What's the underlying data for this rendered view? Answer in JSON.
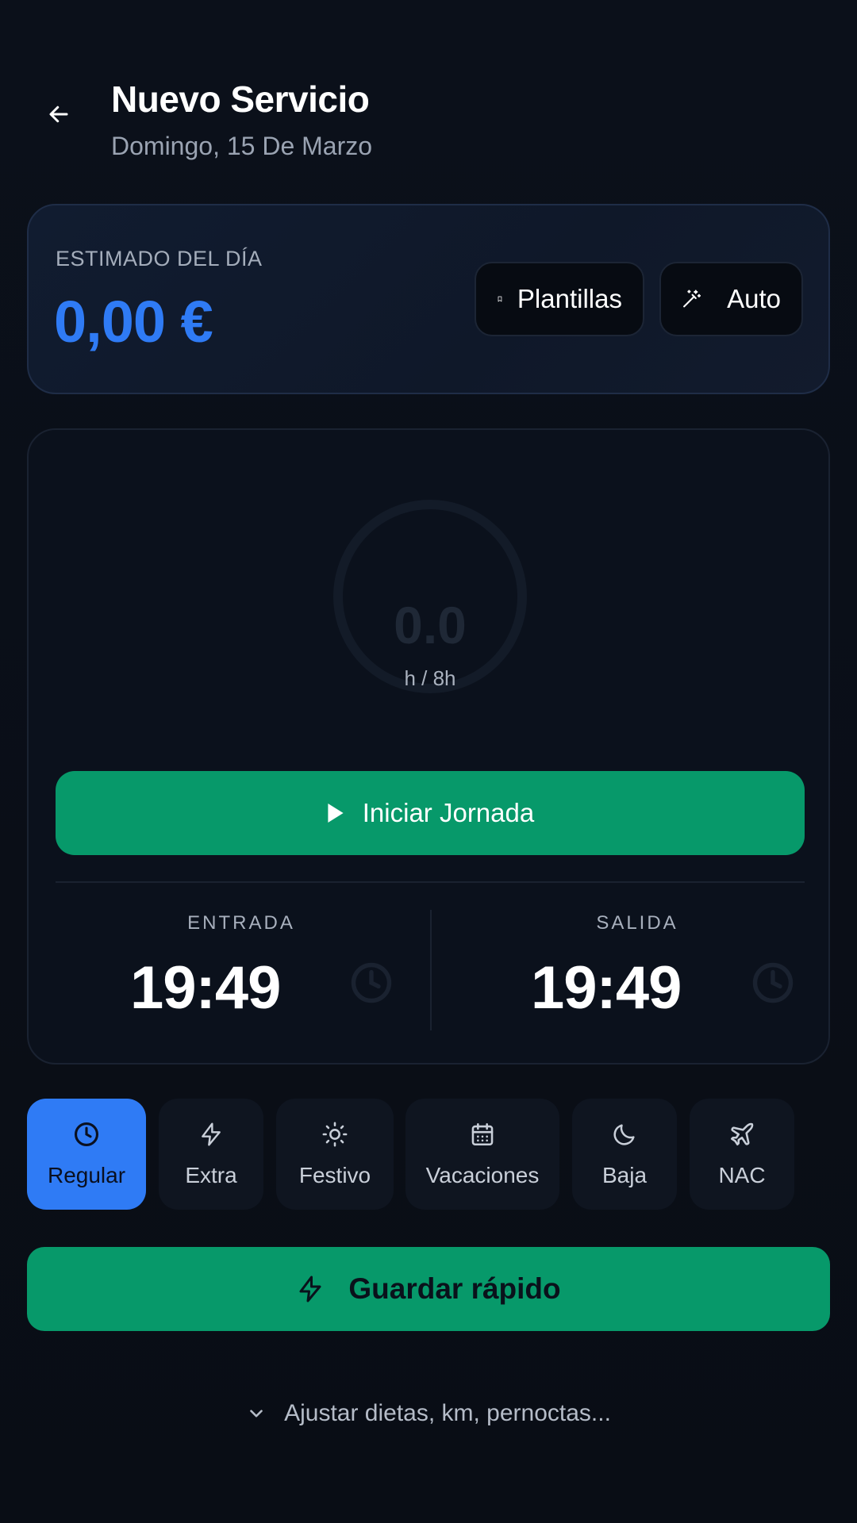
{
  "header": {
    "title": "Nuevo Servicio",
    "subtitle": "Domingo, 15 De Marzo"
  },
  "estimate": {
    "label": "ESTIMADO DEL DÍA",
    "value": "0,00 €",
    "templates_label": "Plantillas",
    "auto_label": "Auto"
  },
  "timer": {
    "hours_value": "0.0",
    "hours_unit": "h / 8h",
    "start_label": "Iniciar Jornada",
    "entrada_label": "ENTRADA",
    "entrada_time": "19:49",
    "salida_label": "SALIDA",
    "salida_time": "19:49"
  },
  "tabs": [
    {
      "label": "Regular",
      "icon": "clock-icon",
      "active": true
    },
    {
      "label": "Extra",
      "icon": "bolt-icon",
      "active": false
    },
    {
      "label": "Festivo",
      "icon": "sun-icon",
      "active": false
    },
    {
      "label": "Vacaciones",
      "icon": "calendar-icon",
      "active": false
    },
    {
      "label": "Baja",
      "icon": "moon-icon",
      "active": false
    },
    {
      "label": "NAC",
      "icon": "plane-icon",
      "active": false
    }
  ],
  "quick_save": {
    "label": "Guardar rápido"
  },
  "adjust": {
    "label": "Ajustar dietas, km, pernoctas..."
  },
  "colors": {
    "accent_blue": "#2f7bf5",
    "accent_green": "#07996a",
    "background": "#0a0e17"
  }
}
